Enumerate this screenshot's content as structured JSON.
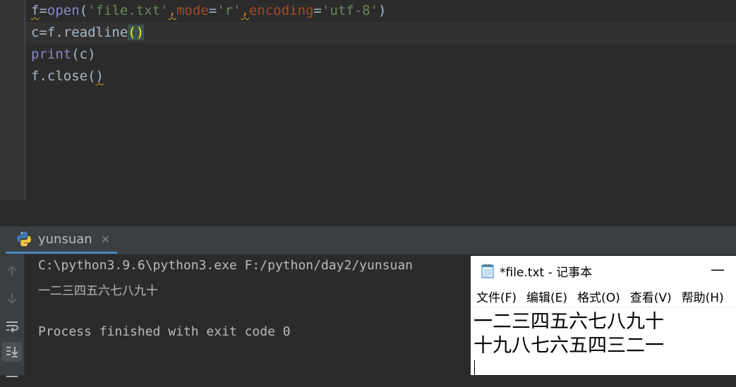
{
  "editor": {
    "line1": {
      "var": "f",
      "eq": "=",
      "func": "open",
      "open_paren": "(",
      "arg_str": "'file.txt'",
      "comma1": ",",
      "kw_mode": "mode",
      "eq2": "=",
      "mode_val": "'r'",
      "comma2": ",",
      "kw_encoding": "encoding",
      "eq3": "=",
      "encoding_val": "'utf-8'",
      "close_paren": ")"
    },
    "line2": {
      "prefix": "c=f.readline",
      "parens": "()"
    },
    "line3": {
      "func": "print",
      "args": "(c)"
    },
    "line4": {
      "prefix": "f.close(",
      "close": ")"
    }
  },
  "run_panel": {
    "tab_label": "yunsuan",
    "close_glyph": "✕",
    "console": {
      "command": "C:\\python3.9.6\\python3.exe F:/python/day2/yunsuan",
      "output": "一二三四五六七八九十",
      "exit": "Process finished with exit code 0"
    },
    "toolbar_icons": [
      "arrow-up-icon",
      "arrow-down-icon",
      "soft-wrap-icon",
      "scroll-to-end-icon"
    ]
  },
  "notepad": {
    "title": "*file.txt - 记事本",
    "minimize_glyph": "—",
    "menu": [
      "文件(F)",
      "编辑(E)",
      "格式(O)",
      "查看(V)",
      "帮助(H)"
    ],
    "lines": [
      "一二三四五六七八九十",
      "十九八七六五四三二一"
    ]
  },
  "colors": {
    "editor_bg": "#2b2b2b",
    "gutter_bg": "#313335",
    "keyword_orange": "#cc7832",
    "string_green": "#6a8759",
    "builtin_purple": "#8888c6",
    "param_orange": "#aa4926",
    "paren_highlight": "#ffef28",
    "active_tab_underline": "#4a88c7"
  }
}
